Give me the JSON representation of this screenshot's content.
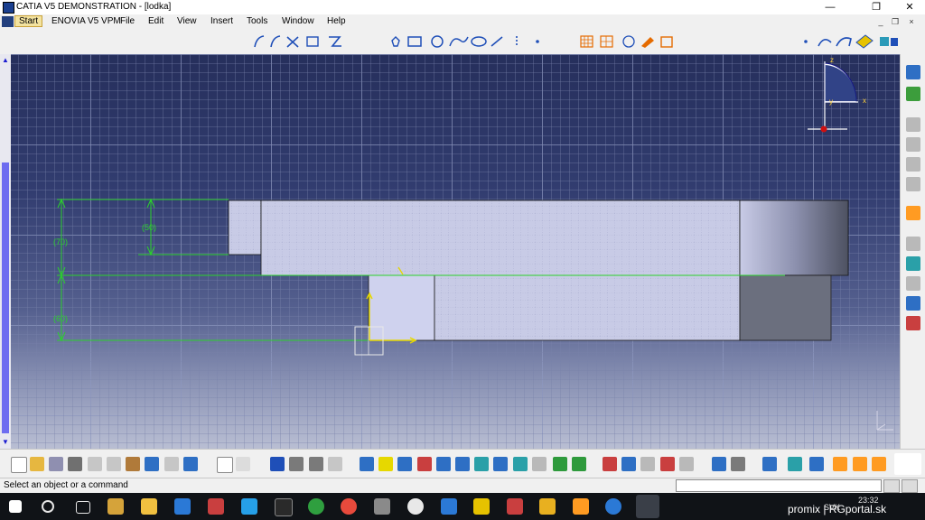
{
  "window": {
    "title": "CATIA V5 DEMONSTRATION - [lodka]",
    "minimize": "—",
    "restore": "❐",
    "close": "✕"
  },
  "menubar": {
    "items": [
      "Start",
      "ENOVIA V5 VPM",
      "File",
      "Edit",
      "View",
      "Insert",
      "Tools",
      "Window",
      "Help"
    ],
    "mdi_controls": [
      "_",
      "❐",
      "×"
    ]
  },
  "sketch": {
    "dimensions": [
      "(70)",
      "(50)",
      "(60)"
    ],
    "colors": {
      "grid_bg": "#2f3a66",
      "dimension_line": "#2bd12b",
      "selection": "#e6d800",
      "part_face": "#bfc2e3",
      "part_dark": "#6b6f7e"
    }
  },
  "compass": {
    "z_label": "z",
    "x_label": "x",
    "y_label": "y"
  },
  "status": {
    "message": "Select an object or a command"
  },
  "taskbar": {
    "time": "23:32",
    "lang": "SVK",
    "apps": [
      "start-icon",
      "search-icon",
      "task-view-icon",
      "file-explorer-icon",
      "store-icon",
      "media-icon",
      "edge-icon",
      "windows-store-icon",
      "mail-icon",
      "skype-icon",
      "spotify-icon",
      "utorrent-icon",
      "chrome-icon",
      "app-icon",
      "itunes-icon",
      "app2-icon",
      "filezilla-icon",
      "app3-icon",
      "vlc-icon",
      "autodesk-icon",
      "app4-icon",
      "catia-icon"
    ]
  },
  "watermark": "promix | RGportal.sk"
}
